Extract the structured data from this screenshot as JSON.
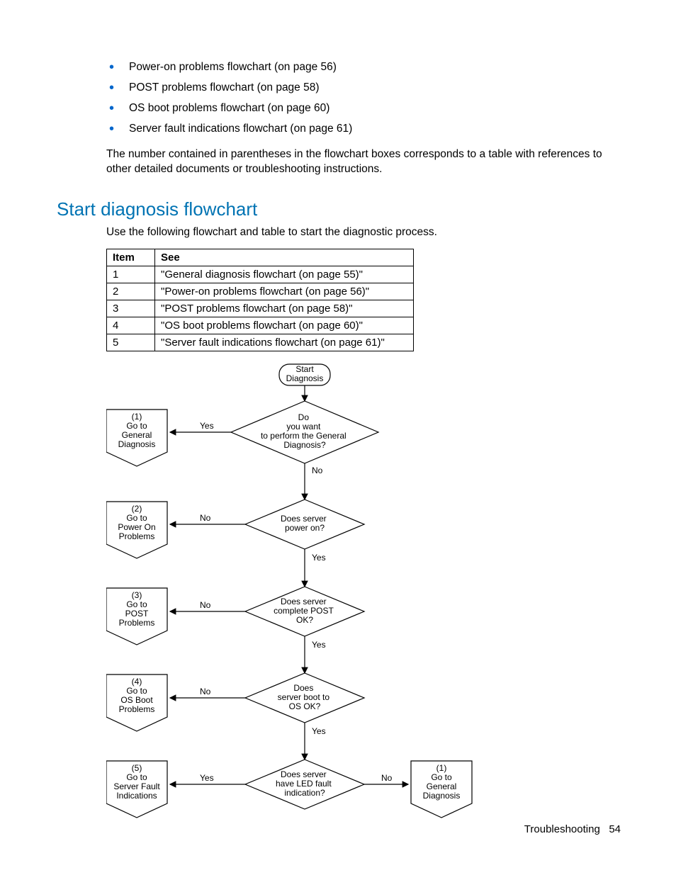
{
  "bullets": [
    "Power-on problems flowchart (on page 56)",
    "POST problems flowchart (on page 58)",
    "OS boot problems flowchart (on page 60)",
    "Server fault indications flowchart (on page 61)"
  ],
  "para": "The number contained in parentheses in the flowchart boxes corresponds to a table with references to other detailed documents or troubleshooting instructions.",
  "heading": "Start diagnosis flowchart",
  "intro": "Use the following flowchart and table to start the diagnostic process.",
  "table": {
    "head": {
      "item": "Item",
      "see": "See"
    },
    "rows": [
      {
        "item": "1",
        "see": "\"General diagnosis flowchart (on page 55)\""
      },
      {
        "item": "2",
        "see": "\"Power-on problems flowchart (on page 56)\""
      },
      {
        "item": "3",
        "see": "\"POST problems flowchart (on page 58)\""
      },
      {
        "item": "4",
        "see": "\"OS boot problems flowchart (on page 60)\""
      },
      {
        "item": "5",
        "see": "\"Server fault indications flowchart (on page 61)\""
      }
    ]
  },
  "flow": {
    "start": "Start\nDiagnosis",
    "d1": "Do\nyou want\nto perform the General\nDiagnosis?",
    "d2": "Does server\npower on?",
    "d3": "Does server\ncomplete POST\nOK?",
    "d4": "Does\nserver boot to\nOS OK?",
    "d5": "Does server\nhave LED fault\nindication?",
    "o1": "(1)\nGo to\nGeneral\nDiagnosis",
    "o2": "(2)\nGo to\nPower On\nProblems",
    "o3": "(3)\nGo to\nPOST\nProblems",
    "o4": "(4)\nGo to\nOS Boot\nProblems",
    "o5": "(5)\nGo to\nServer Fault\nIndications",
    "o6": "(1)\nGo to\nGeneral\nDiagnosis",
    "yes": "Yes",
    "no": "No"
  },
  "footer": {
    "section": "Troubleshooting",
    "page": "54"
  }
}
